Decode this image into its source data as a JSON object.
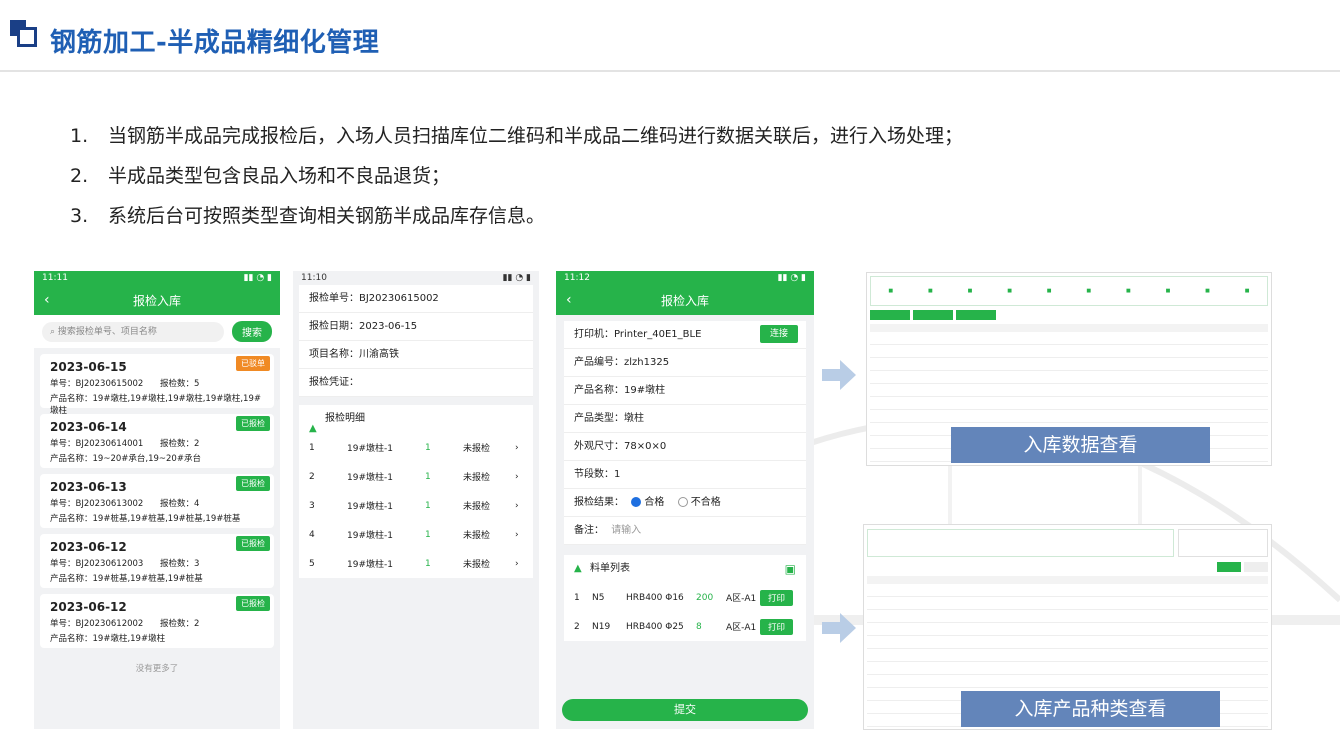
{
  "slide": {
    "title": "钢筋加工-半成品精细化管理",
    "bullets": [
      {
        "num": "1.",
        "text": "当钢筋半成品完成报检后，入场人员扫描库位二维码和半成品二维码进行数据关联后，进行入场处理；"
      },
      {
        "num": "2.",
        "text": "半成品类型包含良品入场和不良品退货；"
      },
      {
        "num": "3.",
        "text": "系统后台可按照类型查询相关钢筋半成品库存信息。"
      }
    ],
    "colors": {
      "title": "#1f5fb4",
      "green": "#26b34a",
      "caption_bg": "#6385ba",
      "orange_badge": "#f08a24"
    }
  },
  "phone1": {
    "time": "11:11",
    "title": "报检入库",
    "search_placeholder": "搜索报检单号、项目名称",
    "search_button": "搜索",
    "cards": [
      {
        "date": "2023-06-15",
        "badge": "已驳单",
        "badge_color": "#f08a24",
        "order": "单号：BJ20230615002",
        "count": "报检数：5",
        "product": "产品名称：19#墩柱,19#墩柱,19#墩柱,19#墩柱,19#墩柱"
      },
      {
        "date": "2023-06-14",
        "badge": "已报检",
        "badge_color": "#26b34a",
        "order": "单号：BJ20230614001",
        "count": "报检数：2",
        "product": "产品名称：19~20#承台,19~20#承台"
      },
      {
        "date": "2023-06-13",
        "badge": "已报检",
        "badge_color": "#26b34a",
        "order": "单号：BJ20230613002",
        "count": "报检数：4",
        "product": "产品名称：19#桩基,19#桩基,19#桩基,19#桩基"
      },
      {
        "date": "2023-06-12",
        "badge": "已报检",
        "badge_color": "#26b34a",
        "order": "单号：BJ20230612003",
        "count": "报检数：3",
        "product": "产品名称：19#桩基,19#桩基,19#桩基"
      },
      {
        "date": "2023-06-12",
        "badge": "已报检",
        "badge_color": "#26b34a",
        "order": "单号：BJ20230612002",
        "count": "报检数：2",
        "product": "产品名称：19#墩柱,19#墩柱"
      }
    ],
    "no_more": "没有更多了"
  },
  "phone2": {
    "time": "11:10",
    "fields": [
      "报检单号：BJ20230615002",
      "报检日期：2023-06-15",
      "项目名称：川渝高铁",
      "报检凭证："
    ],
    "section_title": "报检明细",
    "rows": [
      {
        "idx": "1",
        "name": "19#墩柱-1",
        "qty": "1",
        "status": "未报检"
      },
      {
        "idx": "2",
        "name": "19#墩柱-1",
        "qty": "1",
        "status": "未报检"
      },
      {
        "idx": "3",
        "name": "19#墩柱-1",
        "qty": "1",
        "status": "未报检"
      },
      {
        "idx": "4",
        "name": "19#墩柱-1",
        "qty": "1",
        "status": "未报检"
      },
      {
        "idx": "5",
        "name": "19#墩柱-1",
        "qty": "1",
        "status": "未报检"
      }
    ]
  },
  "phone3": {
    "time": "11:12",
    "title": "报检入库",
    "printer": "打印机：Printer_40E1_BLE",
    "connect": "连接",
    "fields": [
      "产品编号：zlzh1325",
      "产品名称：19#墩柱",
      "产品类型：墩柱",
      "外观尺寸：78×0×0",
      "节段数：1"
    ],
    "result_label": "报检结果：",
    "pass": "合格",
    "fail": "不合格",
    "remark_label": "备注：",
    "remark_placeholder": "请输入",
    "list_title": "料单列表",
    "items": [
      {
        "idx": "1",
        "code": "N5",
        "spec": "HRB400 Φ16",
        "qty": "200",
        "loc": "A区-A1",
        "btn": "打印"
      },
      {
        "idx": "2",
        "code": "N19",
        "spec": "HRB400 Φ25",
        "qty": "8",
        "loc": "A区-A1",
        "btn": "打印"
      }
    ],
    "submit": "提交"
  },
  "screens": {
    "caption1": "入库数据查看",
    "caption2": "入库产品种类查看"
  }
}
